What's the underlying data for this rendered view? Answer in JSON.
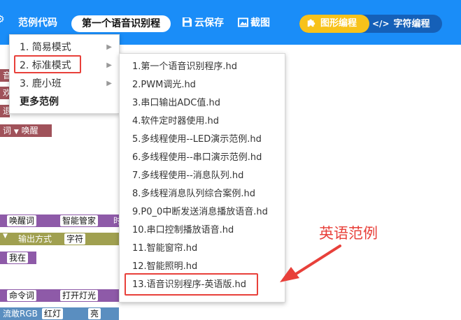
{
  "toolbar": {
    "examples_label": "范例代码",
    "project_title": "第一个语音识别程",
    "cloud_save_label": "云保存",
    "screenshot_label": "截图",
    "graphic_mode_label": "图形编程",
    "text_mode_label": "字符编程"
  },
  "workspace": {
    "frag1": "音",
    "frag2": "欢",
    "frag3": "退",
    "frag4": "词",
    "wake": "唤醒",
    "wake_word": "唤醒词",
    "smart_butler": "智能管家",
    "truncated_time": "时",
    "output_mode": "输出方式",
    "char": "字符",
    "here": "我在",
    "command_word": "命令词",
    "turn_on_light": "打开灯光",
    "rgb": "流敢RGB",
    "red_light": "红灯",
    "bright": "亮"
  },
  "menu1": {
    "items": [
      {
        "label": "1. 简易模式"
      },
      {
        "label": "2. 标准模式"
      },
      {
        "label": "3. 鹿小班"
      },
      {
        "label": "更多范例"
      }
    ]
  },
  "menu2": {
    "items": [
      {
        "label": "1.第一个语音识别程序.hd"
      },
      {
        "label": "2.PWM调光.hd"
      },
      {
        "label": "3.串口输出ADC值.hd"
      },
      {
        "label": "4.软件定时器使用.hd"
      },
      {
        "label": "5.多线程使用--LED演示范例.hd"
      },
      {
        "label": "6.多线程使用--串口演示范例.hd"
      },
      {
        "label": "7.多线程使用--消息队列.hd"
      },
      {
        "label": "8.多线程消息队列综合案例.hd"
      },
      {
        "label": "9.P0_0中断发送消息播放语音.hd"
      },
      {
        "label": "10.串口控制播放语音.hd"
      },
      {
        "label": "11.智能窗帘.hd"
      },
      {
        "label": "12.智能照明.hd"
      },
      {
        "label": "13.语音识别程序-英语版.hd"
      }
    ]
  },
  "annotation": {
    "text": "英语范例",
    "color": "#e8403a"
  },
  "colors": {
    "toolbar": "#1a8df8",
    "graphic_mode": "#f7c21a",
    "text_mode": "#1560b8",
    "block_red": "#a0525a",
    "block_purple": "#8e5aa8",
    "block_olive": "#a0a050"
  }
}
